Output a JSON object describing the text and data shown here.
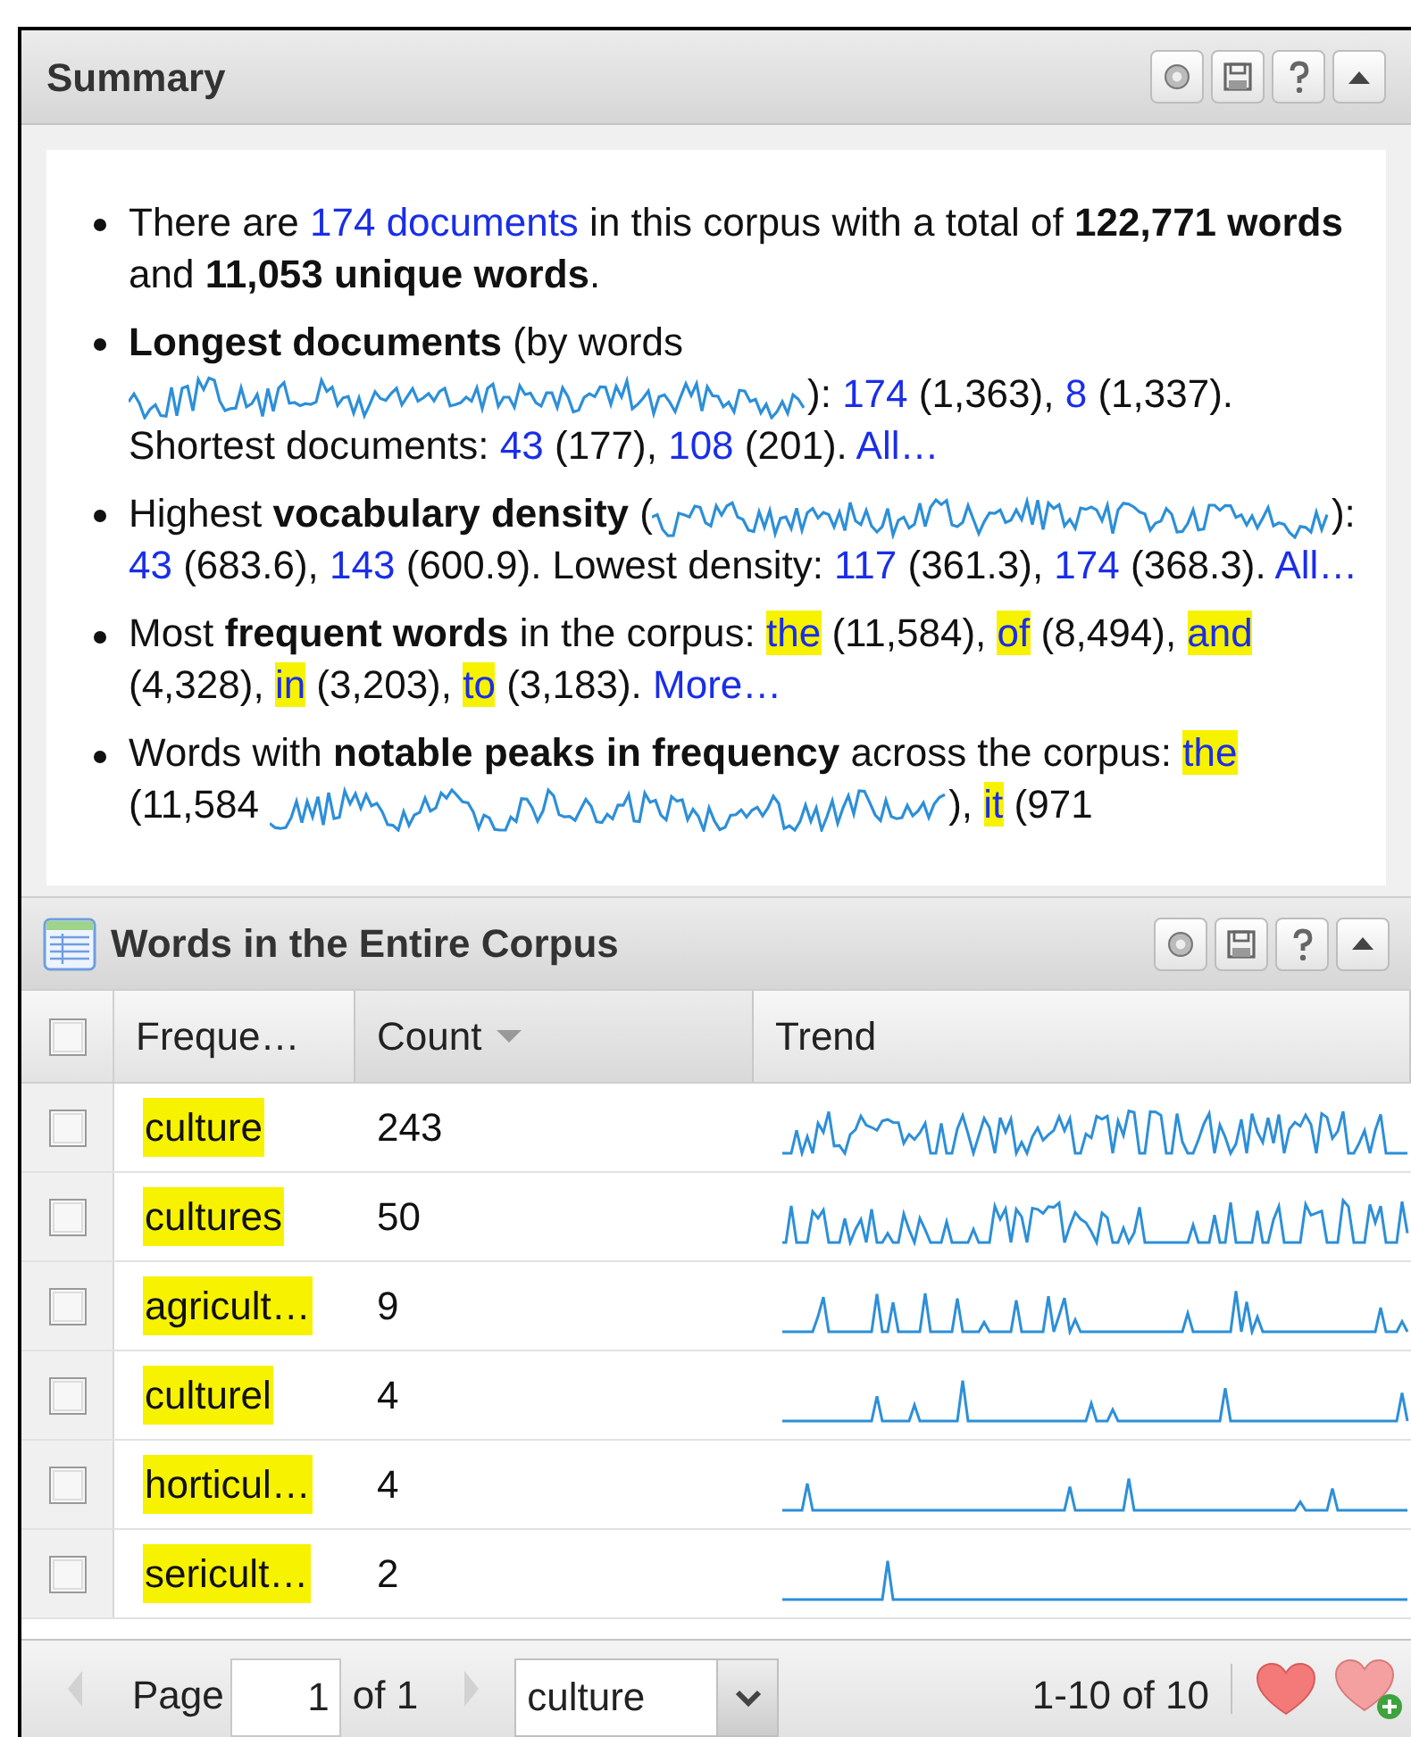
{
  "summary": {
    "title": "Summary",
    "items": [
      {
        "segments": [
          {
            "kind": "text",
            "text": "There are "
          },
          {
            "kind": "link",
            "text": "174 documents"
          },
          {
            "kind": "text",
            "text": " in this corpus with a total of **122,771 words** and **11,053 unique words**."
          }
        ]
      },
      {
        "segments": [
          {
            "kind": "text",
            "text": "**Longest documents** (by words "
          },
          {
            "kind": "sparkline"
          },
          {
            "kind": "text",
            "text": "): "
          },
          {
            "kind": "link",
            "text": "174"
          },
          {
            "kind": "text",
            "text": " (1,363), "
          },
          {
            "kind": "link",
            "text": "8"
          },
          {
            "kind": "text",
            "text": " (1,337). Shortest documents: "
          },
          {
            "kind": "link",
            "text": "43"
          },
          {
            "kind": "text",
            "text": " (177), "
          },
          {
            "kind": "link",
            "text": "108"
          },
          {
            "kind": "text",
            "text": " (201). "
          },
          {
            "kind": "link",
            "text": "All…"
          }
        ]
      },
      {
        "segments": [
          {
            "kind": "text",
            "text": "Highest **vocabulary density** ("
          },
          {
            "kind": "sparkline"
          },
          {
            "kind": "text",
            "text": "): "
          },
          {
            "kind": "link",
            "text": "43"
          },
          {
            "kind": "text",
            "text": " (683.6), "
          },
          {
            "kind": "link",
            "text": "143"
          },
          {
            "kind": "text",
            "text": " (600.9). Lowest density: "
          },
          {
            "kind": "link",
            "text": "117"
          },
          {
            "kind": "text",
            "text": " (361.3), "
          },
          {
            "kind": "link",
            "text": "174"
          },
          {
            "kind": "text",
            "text": " (368.3). "
          },
          {
            "kind": "link",
            "text": "All…"
          }
        ]
      },
      {
        "segments": [
          {
            "kind": "text",
            "text": "Most **frequent words** in the corpus: "
          },
          {
            "kind": "highlight",
            "text": "the"
          },
          {
            "kind": "text",
            "text": " (11,584), "
          },
          {
            "kind": "highlight",
            "text": "of"
          },
          {
            "kind": "text",
            "text": " (8,494), "
          },
          {
            "kind": "highlight",
            "text": "and"
          },
          {
            "kind": "text",
            "text": " (4,328), "
          },
          {
            "kind": "highlight",
            "text": "in"
          },
          {
            "kind": "text",
            "text": " (3,203), "
          },
          {
            "kind": "highlight",
            "text": "to"
          },
          {
            "kind": "text",
            "text": " (3,183). "
          },
          {
            "kind": "link",
            "text": "More…"
          }
        ]
      },
      {
        "segments": [
          {
            "kind": "text",
            "text": "Words with **notable peaks in frequency** across the corpus: "
          },
          {
            "kind": "highlight",
            "text": "the"
          },
          {
            "kind": "text",
            "text": " (11,584 "
          },
          {
            "kind": "sparkline"
          },
          {
            "kind": "text",
            "text": "), "
          },
          {
            "kind": "highlight",
            "text": "it"
          },
          {
            "kind": "text",
            "text": " (971"
          }
        ]
      }
    ]
  },
  "words_panel": {
    "title": "Words in the Entire Corpus",
    "header_checked": false,
    "columns": [
      {
        "label": "Freque…",
        "sorted": false
      },
      {
        "label": "Count",
        "sorted": true
      },
      {
        "label": "Trend",
        "sorted": false
      }
    ],
    "rows": [
      {
        "word": "culture",
        "count": "243",
        "checked": false
      },
      {
        "word": "cultures",
        "count": "50",
        "checked": false
      },
      {
        "word": "agricult…",
        "count": "9",
        "checked": false
      },
      {
        "word": "culturel",
        "count": "4",
        "checked": false
      },
      {
        "word": "horticul…",
        "count": "4",
        "checked": false
      },
      {
        "word": "sericult…",
        "count": "2",
        "checked": false
      }
    ],
    "pager": {
      "prev_disabled": true,
      "page_label": "Page",
      "page": "1",
      "of": "of 1",
      "next_disabled": true,
      "query": "culture",
      "range": "1-10 of 10"
    }
  }
}
